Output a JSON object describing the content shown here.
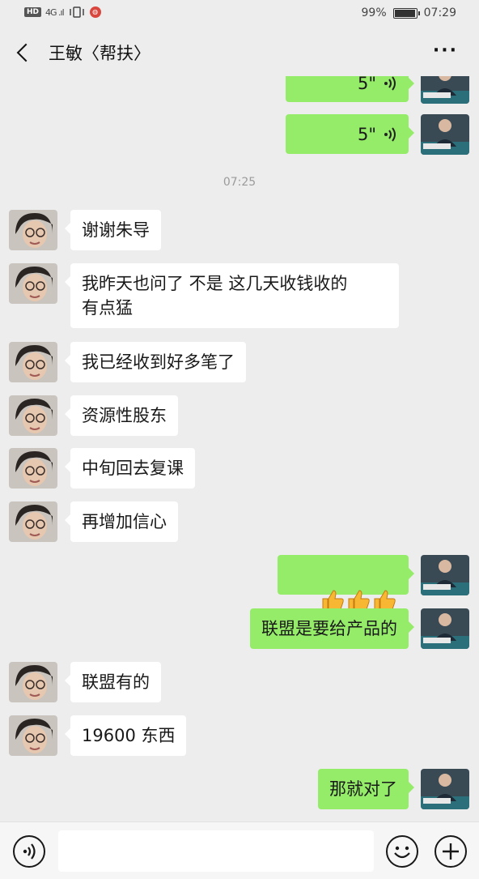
{
  "status_bar": {
    "hd": "HD",
    "signal": "4G .ıl",
    "battery_percent": "99%",
    "battery_level": 0.99,
    "time": "07:29"
  },
  "header": {
    "title": "王敏〈帮扶〉"
  },
  "chat": {
    "voice_messages": [
      {
        "duration": "5\""
      },
      {
        "duration": "5\""
      }
    ],
    "time_divider": "07:25",
    "incoming": [
      {
        "text": "谢谢朱导"
      },
      {
        "text": "我昨天也问了 不是 这几天收钱收的\n有点猛"
      },
      {
        "text": "我已经收到好多笔了"
      },
      {
        "text": "资源性股东"
      },
      {
        "text": "中旬回去复课"
      },
      {
        "text": "再增加信心"
      },
      {
        "text": "联盟有的"
      },
      {
        "text": "19600 东西"
      }
    ],
    "outgoing": [
      {
        "text": "👍👍👍"
      },
      {
        "text": "联盟是要给产品的"
      },
      {
        "text": "那就对了"
      }
    ]
  },
  "icons": {
    "back": "back-arrow-icon",
    "more": "more-icon",
    "voice_input": "voice-input-icon",
    "emoji": "emoji-icon",
    "plus": "plus-icon"
  },
  "colors": {
    "background": "#ededed",
    "outgoing_bubble": "#95ec69",
    "incoming_bubble": "#ffffff"
  }
}
